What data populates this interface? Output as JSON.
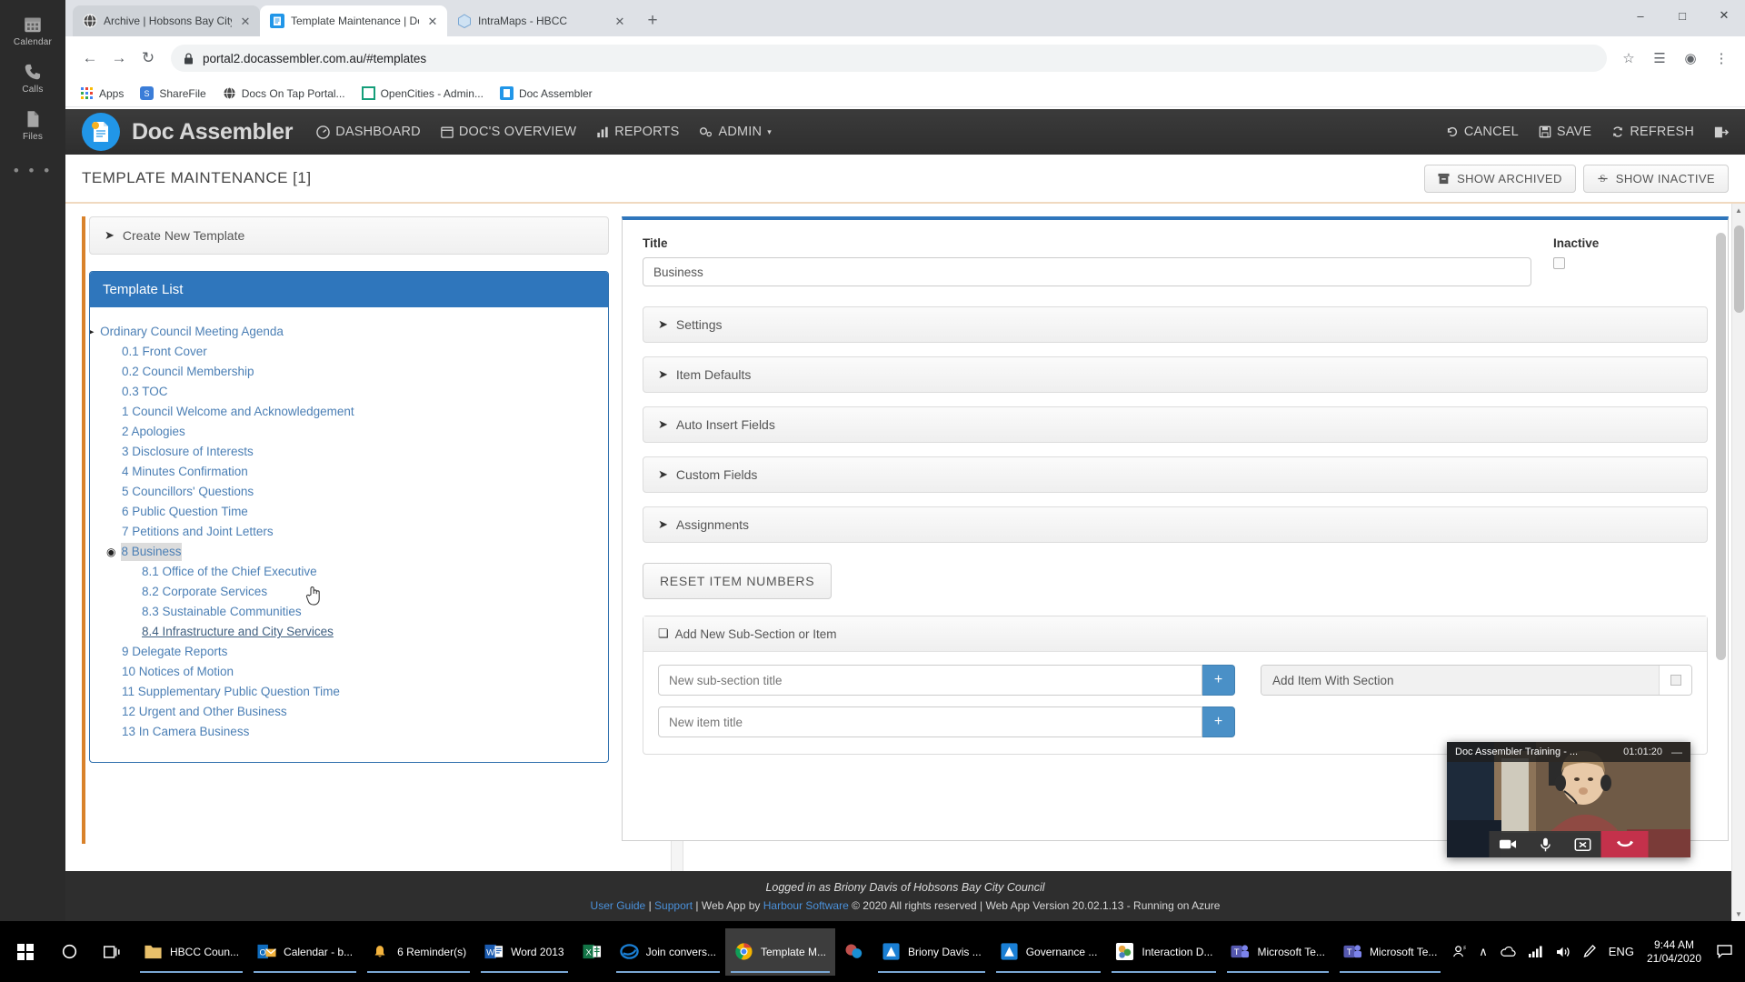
{
  "teams_rail": {
    "items": [
      {
        "label": "Calendar",
        "icon": "calendar-icon"
      },
      {
        "label": "Calls",
        "icon": "phone-icon"
      },
      {
        "label": "Files",
        "icon": "file-icon"
      }
    ],
    "more": "• • •"
  },
  "browser": {
    "tabs": [
      {
        "title": "Archive | Hobsons Bay City Coun",
        "favicon": "globe-icon",
        "active": false
      },
      {
        "title": "Template Maintenance | Doc Ass",
        "favicon": "doc-assembler-icon",
        "active": true
      },
      {
        "title": "IntraMaps - HBCC",
        "favicon": "intramaps-icon",
        "active": false
      }
    ],
    "new_tab_label": "+",
    "window_controls": {
      "minimize": "–",
      "maximize": "□",
      "close": "✕"
    },
    "nav": {
      "back": "←",
      "forward": "→",
      "reload": "↻"
    },
    "address": "portal2.docassembler.com.au/#templates",
    "lock_icon": "padlock-icon",
    "star_icon": "star-icon",
    "extensions_icon": "extensions-icon",
    "profile_icon": "profile-avatar-icon",
    "menu_icon": "kebab-menu-icon",
    "bookmarks": [
      {
        "label": "Apps",
        "icon": "apps-grid-icon"
      },
      {
        "label": "ShareFile",
        "icon": "sharefile-icon"
      },
      {
        "label": "Docs On Tap Portal...",
        "icon": "globe-icon"
      },
      {
        "label": "OpenCities - Admin...",
        "icon": "opencities-icon"
      },
      {
        "label": "Doc Assembler",
        "icon": "doc-assembler-icon"
      }
    ]
  },
  "app": {
    "brand": "Doc Assembler",
    "nav": [
      {
        "label": "DASHBOARD",
        "icon": "dashboard-icon"
      },
      {
        "label": "DOC'S OVERVIEW",
        "icon": "calendar-icon"
      },
      {
        "label": "REPORTS",
        "icon": "bar-chart-icon"
      },
      {
        "label": "ADMIN",
        "icon": "cogs-icon",
        "caret": "▾"
      }
    ],
    "actions": [
      {
        "label": "CANCEL",
        "icon": "undo-icon"
      },
      {
        "label": "SAVE",
        "icon": "floppy-icon"
      },
      {
        "label": "REFRESH",
        "icon": "refresh-icon"
      }
    ],
    "logout_icon": "logout-icon",
    "page_title": "TEMPLATE MAINTENANCE [1]",
    "head_buttons": [
      {
        "label": "SHOW ARCHIVED",
        "icon": "archive-icon"
      },
      {
        "label": "SHOW INACTIVE",
        "icon": "strikethrough-s-icon"
      }
    ]
  },
  "left_panel": {
    "create_new_template": "Create New Template",
    "template_list_header": "Template List",
    "tree": [
      {
        "label": "Ordinary Council Meeting Agenda",
        "level": 0,
        "bullet": "right",
        "state": "normal"
      },
      {
        "label": "0.1 Front Cover",
        "level": 1,
        "bullet": "none",
        "state": "normal"
      },
      {
        "label": "0.2 Council Membership",
        "level": 1,
        "bullet": "none",
        "state": "normal"
      },
      {
        "label": "0.3 TOC",
        "level": 1,
        "bullet": "none",
        "state": "normal"
      },
      {
        "label": "1 Council Welcome and Acknowledgement",
        "level": 1,
        "bullet": "none",
        "state": "normal"
      },
      {
        "label": "2 Apologies",
        "level": 1,
        "bullet": "none",
        "state": "normal"
      },
      {
        "label": "3 Disclosure of Interests",
        "level": 1,
        "bullet": "none",
        "state": "normal"
      },
      {
        "label": "4 Minutes Confirmation",
        "level": 1,
        "bullet": "none",
        "state": "normal"
      },
      {
        "label": "5 Councillors' Questions",
        "level": 1,
        "bullet": "none",
        "state": "normal"
      },
      {
        "label": "6 Public Question Time",
        "level": 1,
        "bullet": "none",
        "state": "normal"
      },
      {
        "label": "7 Petitions and Joint Letters",
        "level": 1,
        "bullet": "none",
        "state": "normal"
      },
      {
        "label": "8 Business",
        "level": 1,
        "bullet": "down",
        "state": "selected"
      },
      {
        "label": "8.1 Office of the Chief Executive",
        "level": 2,
        "bullet": "none",
        "state": "normal"
      },
      {
        "label": "8.2 Corporate Services",
        "level": 2,
        "bullet": "none",
        "state": "normal"
      },
      {
        "label": "8.3 Sustainable Communities",
        "level": 2,
        "bullet": "none",
        "state": "normal"
      },
      {
        "label": "8.4 Infrastructure and City Services",
        "level": 2,
        "bullet": "none",
        "state": "hover"
      },
      {
        "label": "9 Delegate Reports",
        "level": 1,
        "bullet": "none",
        "state": "normal"
      },
      {
        "label": "10 Notices of Motion",
        "level": 1,
        "bullet": "none",
        "state": "normal"
      },
      {
        "label": "11 Supplementary Public Question Time",
        "level": 1,
        "bullet": "none",
        "state": "normal"
      },
      {
        "label": "12 Urgent and Other Business",
        "level": 1,
        "bullet": "none",
        "state": "normal"
      },
      {
        "label": "13 In Camera Business",
        "level": 1,
        "bullet": "none",
        "state": "normal"
      }
    ]
  },
  "right_panel": {
    "title_label": "Title",
    "title_value": "Business",
    "inactive_label": "Inactive",
    "inactive_checked": false,
    "accordions": [
      {
        "label": "Settings"
      },
      {
        "label": "Item Defaults"
      },
      {
        "label": "Auto Insert Fields"
      },
      {
        "label": "Custom Fields"
      },
      {
        "label": "Assignments"
      }
    ],
    "reset_button": "RESET ITEM NUMBERS",
    "add_section": {
      "header": "Add New Sub-Section or Item",
      "subsection_placeholder": "New sub-section title",
      "item_placeholder": "New item title",
      "add_button": "+",
      "add_item_with_section_label": "Add Item With Section"
    }
  },
  "footer": {
    "logged_in": "Logged in as Briony Davis of Hobsons Bay City Council",
    "user_guide": "User Guide",
    "support": "Support",
    "by_prefix": "Web App by",
    "vendor": "Harbour Software",
    "copyright": "© 2020 All rights reserved | Web App Version 20.02.1.13 - Running on Azure",
    "separator": "|"
  },
  "call_pip": {
    "title": "Doc Assembler Training - ...",
    "duration": "01:01:20",
    "minimize": "—",
    "controls": [
      {
        "name": "camera-icon"
      },
      {
        "name": "microphone-icon"
      },
      {
        "name": "share-screen-icon"
      },
      {
        "name": "hangup-icon"
      }
    ]
  },
  "taskbar": {
    "start_icon": "windows-start-icon",
    "search_icon": "search-circle-icon",
    "taskview_icon": "task-view-icon",
    "tasks": [
      {
        "label": "HBCC Coun...",
        "icon": "folder-icon",
        "active": false,
        "running": true
      },
      {
        "label": "Calendar - b...",
        "icon": "outlook-icon",
        "active": false,
        "running": true
      },
      {
        "label": "6 Reminder(s)",
        "icon": "bell-icon",
        "active": false,
        "running": true
      },
      {
        "label": "Word 2013",
        "icon": "word-icon",
        "active": false,
        "running": true
      },
      {
        "label": "",
        "icon": "excel-icon",
        "active": false,
        "running": false
      },
      {
        "label": "Join convers...",
        "icon": "ie-icon",
        "active": false,
        "running": true
      },
      {
        "label": "Template M...",
        "icon": "chrome-icon",
        "active": true,
        "running": true
      },
      {
        "label": "",
        "icon": "skype-icon",
        "active": false,
        "running": false
      },
      {
        "label": "Briony Davis ...",
        "icon": "bluebox-icon",
        "active": false,
        "running": true
      },
      {
        "label": "Governance ...",
        "icon": "bluebox-icon",
        "active": false,
        "running": true
      },
      {
        "label": "Interaction D...",
        "icon": "interaction-icon",
        "active": false,
        "running": true
      },
      {
        "label": "Microsoft Te...",
        "icon": "teams-icon",
        "active": false,
        "running": true
      },
      {
        "label": "Microsoft Te...",
        "icon": "teams-icon",
        "active": false,
        "running": true
      }
    ],
    "tray": {
      "people_icon": "people-icon",
      "chevron_up": "∧",
      "onedrive_icon": "onedrive-icon",
      "network_icon": "network-bars-icon",
      "volume_icon": "volume-icon",
      "pen_icon": "pen-icon",
      "language": "ENG",
      "time": "9:44 AM",
      "date": "21/04/2020",
      "action_center_icon": "action-center-icon"
    }
  },
  "colors": {
    "accent_blue": "#2f76bc",
    "appbar_dark": "#2e2e2e",
    "orange_rule": "#d9822b",
    "link_blue": "#4b7fb5",
    "hangup_red": "#c4314b"
  }
}
